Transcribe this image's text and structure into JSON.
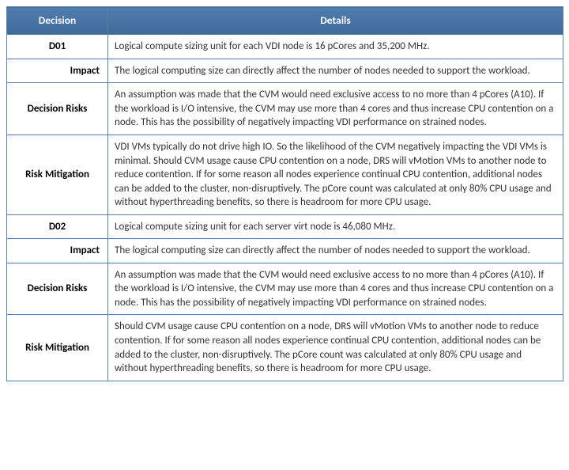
{
  "headers": {
    "col1": "Decision",
    "col2": "Details"
  },
  "rows": [
    {
      "kind": "main",
      "label": "D01",
      "details": "Logical compute sizing unit for each VDI node is 16 pCores and 35,200 MHz."
    },
    {
      "kind": "sub",
      "label": "Impact",
      "details": "The logical computing size can directly affect the number of nodes needed to support the workload."
    },
    {
      "kind": "main",
      "label": "Decision Risks",
      "details": "An assumption was made that the CVM would need exclusive access to no more than 4 pCores (A10). If the workload is I/O intensive, the CVM may use more than 4 cores and thus increase CPU contention on a node. This has the possibility of negatively impacting VDI performance on strained nodes."
    },
    {
      "kind": "main",
      "label": "Risk Mitigation",
      "details": "VDI VMs typically do not drive high IO. So the likelihood of the CVM negatively impacting the VDI VMs is minimal. Should CVM usage cause CPU contention on a node, DRS will vMotion VMs to another node to reduce contention. If for some reason all nodes experience continual CPU contention, additional nodes can be added to the cluster, non-disruptively. The pCore count was calculated at only 80% CPU usage and without hyperthreading benefits, so there is headroom for more CPU usage."
    },
    {
      "kind": "main",
      "label": "D02",
      "details": "Logical compute sizing unit for each server virt node is 46,080 MHz."
    },
    {
      "kind": "sub",
      "label": "Impact",
      "details": "The logical computing size can directly affect the number of nodes needed to support the workload."
    },
    {
      "kind": "main",
      "label": "Decision Risks",
      "details": "An assumption was made that the CVM would need exclusive access to no more than 4 pCores (A10). If the workload is I/O intensive, the CVM may use more than 4 cores and thus increase CPU contention on a node. This has the possibility of negatively impacting VDI performance on strained nodes."
    },
    {
      "kind": "main",
      "label": "Risk Mitigation",
      "details": "Should CVM usage cause CPU contention on a node, DRS will vMotion VMs to another node to reduce contention. If for some reason all nodes experience continual CPU contention, additional nodes can be added to the cluster, non-disruptively. The pCore count was calculated at only 80% CPU usage and without hyperthreading benefits, so there is headroom for more CPU usage."
    }
  ]
}
